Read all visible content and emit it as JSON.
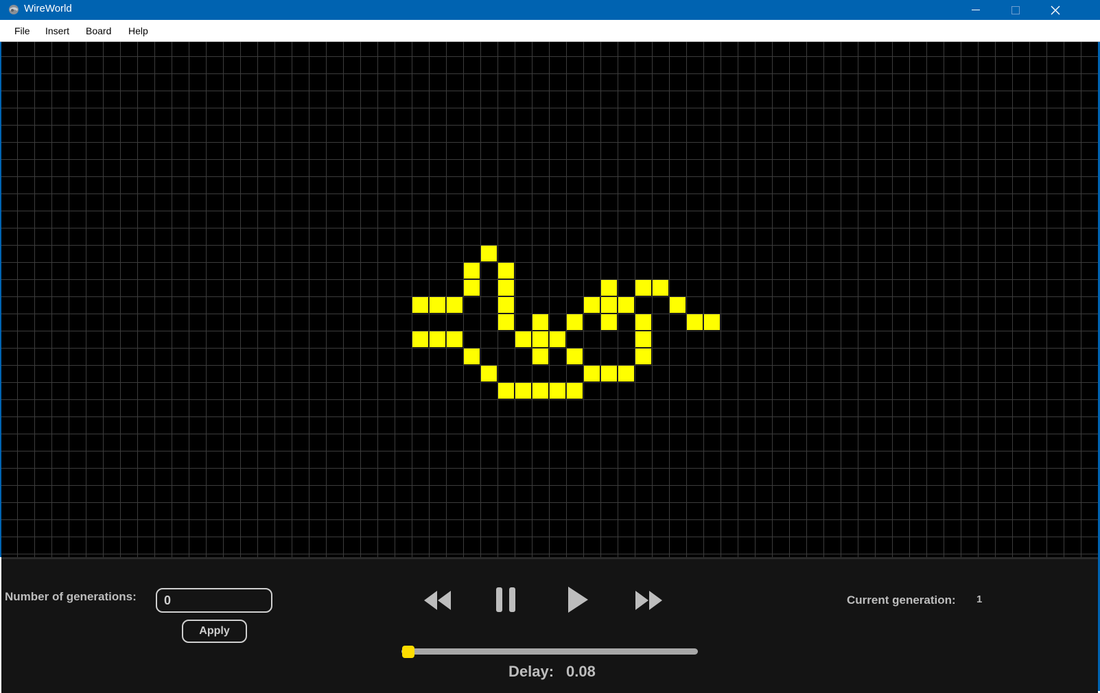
{
  "window": {
    "title": "WireWorld"
  },
  "menu": [
    "File",
    "Insert",
    "Board",
    "Help"
  ],
  "board": {
    "cell_color": "#ffff00",
    "grid_color": "#3c3c3c",
    "background": "#000000",
    "cells": [
      [
        27,
        11
      ],
      [
        26,
        12
      ],
      [
        28,
        12
      ],
      [
        26,
        13
      ],
      [
        28,
        13
      ],
      [
        34,
        13
      ],
      [
        36,
        13
      ],
      [
        37,
        13
      ],
      [
        23,
        14
      ],
      [
        24,
        14
      ],
      [
        25,
        14
      ],
      [
        28,
        14
      ],
      [
        33,
        14
      ],
      [
        34,
        14
      ],
      [
        35,
        14
      ],
      [
        38,
        14
      ],
      [
        28,
        15
      ],
      [
        30,
        15
      ],
      [
        32,
        15
      ],
      [
        34,
        15
      ],
      [
        36,
        15
      ],
      [
        39,
        15
      ],
      [
        40,
        15
      ],
      [
        23,
        16
      ],
      [
        24,
        16
      ],
      [
        25,
        16
      ],
      [
        29,
        16
      ],
      [
        30,
        16
      ],
      [
        31,
        16
      ],
      [
        36,
        16
      ],
      [
        26,
        17
      ],
      [
        30,
        17
      ],
      [
        32,
        17
      ],
      [
        36,
        17
      ],
      [
        27,
        18
      ],
      [
        33,
        18
      ],
      [
        34,
        18
      ],
      [
        35,
        18
      ],
      [
        28,
        19
      ],
      [
        29,
        19
      ],
      [
        30,
        19
      ],
      [
        31,
        19
      ],
      [
        32,
        19
      ]
    ]
  },
  "controls": {
    "generations_label": "Number of generations:",
    "generations_value": "0",
    "apply_label": "Apply",
    "rewind_icon": "rewind-icon",
    "pause_icon": "pause-icon",
    "play_icon": "play-icon",
    "fast_forward_icon": "fast-forward-icon",
    "delay_label": "Delay:",
    "delay_value": "0.08",
    "delay_slider_fraction": 0.0,
    "current_generation_label": "Current generation:",
    "current_generation_value": "1"
  }
}
